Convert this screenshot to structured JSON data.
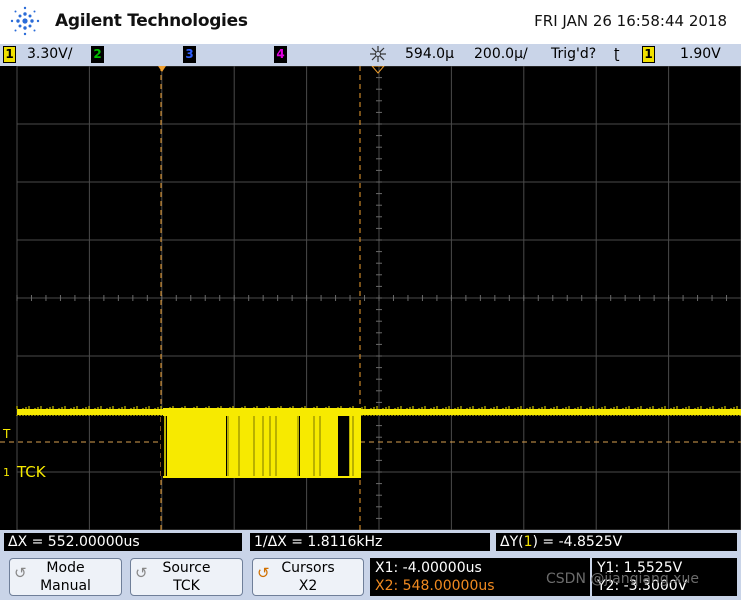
{
  "header": {
    "brand": "Agilent Technologies",
    "datetime": "FRI JAN 26 16:58:44 2018"
  },
  "status_bar": {
    "ch1_label": "1",
    "ch1_scale": "3.30V/",
    "ch2_label": "2",
    "ch3_label": "3",
    "ch4_label": "4",
    "time_position": "594.0µ",
    "time_scale": "200.0µ/",
    "trigger_status": "Trig'd?",
    "trigger_icon": "ʈ",
    "trigger_channel": "1",
    "trigger_level": "1.90V",
    "colors": {
      "ch1": "#f0e000",
      "ch2": "#00c000",
      "ch3": "#3060ff",
      "ch4": "#e000e0"
    }
  },
  "waveform": {
    "label": "TCK",
    "channel_marker": "1",
    "trigger_marker": "T",
    "color": "#f7ea00"
  },
  "cursor_readout": {
    "delta_x": "ΔX = 552.00000us",
    "inv_delta_x": "1/ΔX = 1.8116kHz",
    "delta_y_prefix": "ΔY(",
    "delta_y_channel": "1",
    "delta_y_suffix": ") = -4.8525V"
  },
  "softkeys": {
    "mode_title": "Mode",
    "mode_value": "Manual",
    "source_title": "Source",
    "source_value": "TCK",
    "cursors_title": "Cursors",
    "cursors_value": "X2",
    "rotate_icon": "↺"
  },
  "readout": {
    "x1": "X1: -4.00000us",
    "x2": "X2: 548.00000us",
    "y1": "Y1: 1.5525V",
    "y2": "Y2: -3.3000V"
  },
  "watermark": "CSDN @jianqiang.xue"
}
